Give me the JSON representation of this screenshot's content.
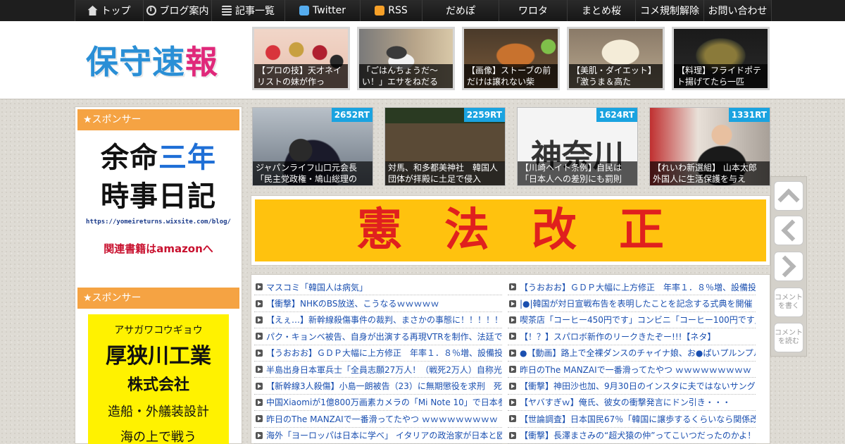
{
  "nav": [
    {
      "label": "トップ",
      "icon": "home-icon"
    },
    {
      "label": "ブログ案内",
      "icon": "info-icon"
    },
    {
      "label": "記事一覧",
      "icon": "list-icon"
    },
    {
      "label": "Twitter",
      "icon": "twitter-icon"
    },
    {
      "label": "RSS",
      "icon": "rss-icon"
    },
    {
      "label": "だめぽ"
    },
    {
      "label": "ワロタ"
    },
    {
      "label": "まとめ桜"
    },
    {
      "label": "コメ規制解除"
    },
    {
      "label": "お問い合わせ"
    }
  ],
  "logo": {
    "c1": "保",
    "c2": "守",
    "c3": "速",
    "c4": "報"
  },
  "thumbs": [
    {
      "caption": "【プロの技】天才ネイリストの妹が作っ"
    },
    {
      "caption": "「ごはんちょうだ～い！」エサをねだる"
    },
    {
      "caption": "【画像】ストーブの前だけは譲れない柴"
    },
    {
      "caption": "【美肌・ダイエット】「激うま＆高た"
    },
    {
      "caption": "【料理】フライドポテト揚げてたら一匹"
    }
  ],
  "sidebar": {
    "sponsor1": "★スポンサー",
    "ad1": {
      "line1a": "余命",
      "line1b": "三年",
      "line2": "時事日記",
      "url": "https://yomeireturns.wixsite.com/blog/",
      "amazon": "関連書籍はamazonへ"
    },
    "sponsor2": "★スポンサー",
    "ad2": {
      "kana": "アサガワコウギョウ",
      "name": "厚狭川工業",
      "company": "株式会社",
      "biz": "造船・外艤装設計",
      "sea": "海の上で戦う"
    }
  },
  "ranking": [
    {
      "rt": "2652RT",
      "caption": "ジャパンライフ山口元会長「民主党政権・鳩山総理の"
    },
    {
      "rt": "2259RT",
      "caption": "対馬、和多都美神社　韓国人団体が拝殿に土足で侵入"
    },
    {
      "rt": "1624RT",
      "caption": "【川崎ヘイト条例】自民は「日本人への差別にも罰則"
    },
    {
      "rt": "1331RT",
      "caption": "【れいわ新選組】 山本太郎　外国人に生活保護を与え"
    }
  ],
  "rank_images": {
    "r3_text": "神奈川"
  },
  "banner": {
    "text": "憲法改正"
  },
  "list_left": [
    "マスコミ「韓国人は病気」",
    "【衝撃】NHKのBS放送、こうなるｗｗｗｗｗ",
    "【えぇ…】新幹線殺傷事件の裁判、まさかの事態に！！！！！",
    "パク・キョンベ被告、自身が出演する再現VTRを制作、法廷で",
    "【うおおお】ＧＤＰ大幅に上方修正　年率１．８％増、設備投",
    "半島出身日本軍兵士「全員志願27万人！（戦死2万人）自称光復",
    "【新幹線3人殺傷】小島一朗被告（23）に無期懲役を求刑　死刑",
    "中国Xiaomiが1億800万画素カメラの「Mi Note 10」で日本参入",
    "昨日のThe MANZAIで一番滑ってたやつ ｗｗｗｗｗｗｗｗｗ",
    "海外「ヨーロッパは日本に学べ」 イタリアの政治家が日本と欧"
  ],
  "list_right": [
    "【うおおお】ＧＤＰ大幅に上方修正　年率１．８％増、設備投",
    "|●|韓国が対日宣戦布告を表明したことを記念する式典を開催",
    "喫茶店「コーヒー450円です」コンビニ「コーヒー100円です」",
    "【！？】スパロボ新作のリークきたぞー!!!【ネタ】",
    "●【動画】路上で全裸ダンスのチャイナ娘、お●ぱいプルンプル",
    "昨日のThe MANZAIで一番滑ってたやつ ｗｗｗｗｗｗｗｗｗ",
    "【衝撃】神田沙也加、9月30日のインスタに夫ではないサングラ",
    "【ヤバすぎｗ】俺氏、彼女の衝撃発言にドン引き・・・",
    "【世論調査】日本国民67％「韓国に譲歩するくらいなら関係改",
    "【衝撃】長澤まさみの“超犬猿の仲”ってこいつだったのかよ！"
  ],
  "tools": {
    "comment_write": "コメントを書く",
    "comment_read": "コメントを読む"
  },
  "colors": {
    "nav_bg": "#1e1e1e",
    "sponsor_orange": "#f5a343",
    "rt_blue": "#1aa3e0",
    "link_blue": "#1a4fb0",
    "banner_yellow": "#ffc20e",
    "banner_red": "#e0201e"
  }
}
